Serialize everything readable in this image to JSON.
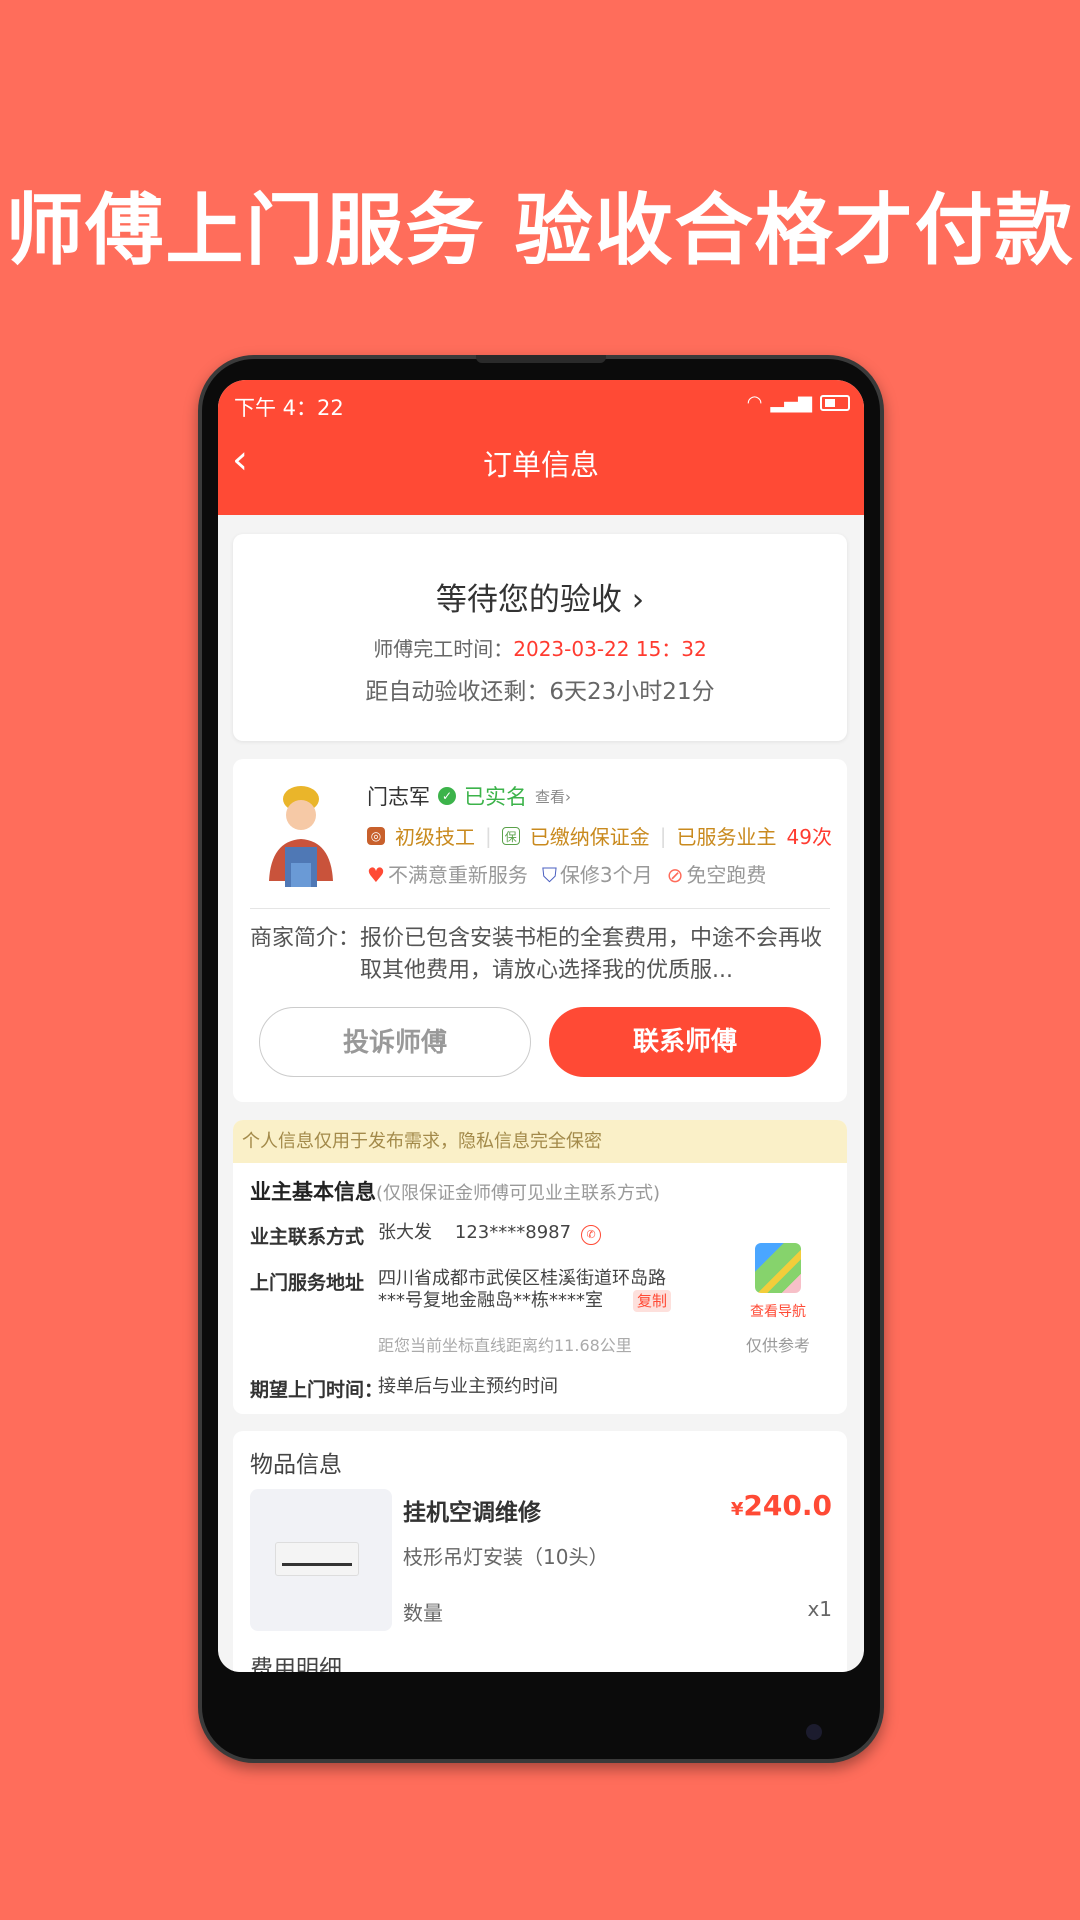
{
  "headline": "师傅上门服务 验收合格才付款",
  "status_bar": {
    "time": "下午 4：22",
    "wifi": "wifi-icon",
    "signal": "signal-icon",
    "battery": "battery-icon"
  },
  "nav": {
    "back": "‹",
    "title": "订单信息"
  },
  "status_card": {
    "status": "等待您的验收",
    "chevron": "›",
    "finish_label": "师傅完工时间：",
    "finish_time": "2023-03-22  15：32",
    "remaining": "距自动验收还剩：6天23小时21分"
  },
  "worker": {
    "name": "门志军",
    "verified": "已实名",
    "view": "查看›",
    "level": "初级技工",
    "deposit": "已缴纳保证金",
    "served_label": "已服务业主",
    "served_count": "49次",
    "guarantees": [
      "不满意重新服务",
      "保修3个月",
      "免空跑费"
    ],
    "intro_label": "商家简介：",
    "intro": "报价已包含安装书柜的全套费用，中途不会再收取其他费用，请放心选择我的优质服...",
    "complain": "投诉师傅",
    "contact": "联系师傅"
  },
  "owner": {
    "banner": "个人信息仅用于发布需求，隐私信息完全保密",
    "title": "业主基本信息",
    "title_note": "(仅限保证金师傅可见业主联系方式)",
    "contact_label": "业主联系方式",
    "contact_name": "张大发",
    "contact_phone": "123****8987",
    "address_label": "上门服务地址",
    "address": "四川省成都市武侯区桂溪街道环岛路***号复地金融岛**栋****室",
    "copy": "复制",
    "distance": "距您当前坐标直线距离约11.68公里",
    "nav": "查看导航",
    "ref": "仅供参考",
    "time_label": "期望上门时间：",
    "time_value": "接单后与业主预约时间"
  },
  "goods": {
    "title": "物品信息",
    "name": "挂机空调维修",
    "currency": "¥",
    "price": "240.0",
    "spec": "枝形吊灯安装（10头）",
    "qty_label": "数量",
    "qty": "x1",
    "fee_title": "费用明细"
  },
  "colors": {
    "accent": "#ff4a35",
    "background": "#ff6d5b",
    "verified": "#3cb34a"
  }
}
